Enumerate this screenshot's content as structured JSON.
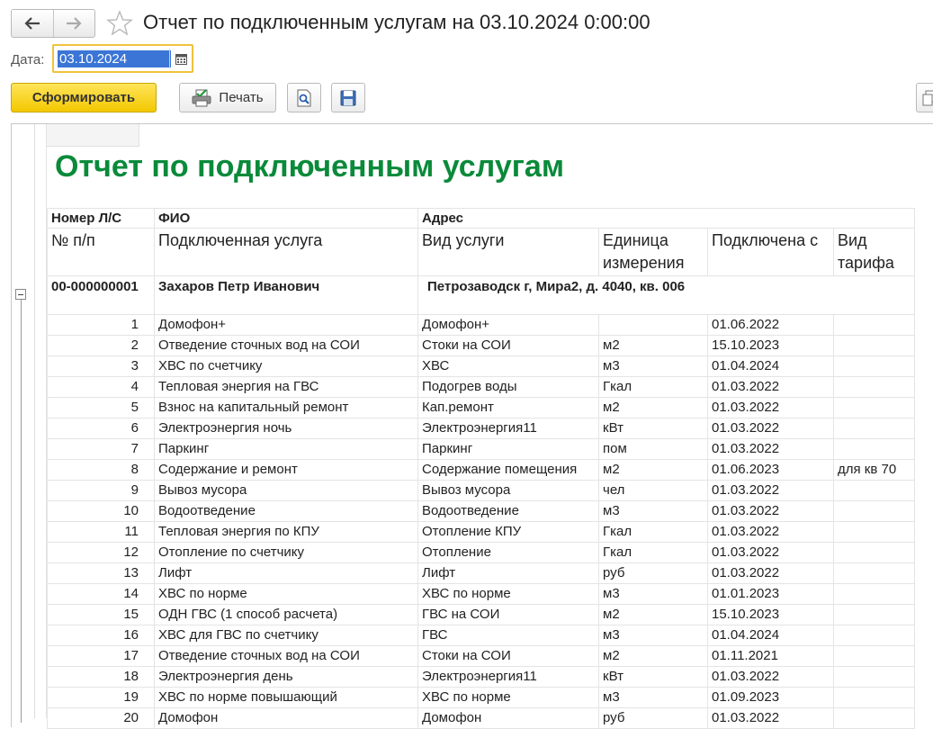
{
  "window": {
    "title": "Отчет по подключенным услугам на 03.10.2024 0:00:00"
  },
  "params": {
    "date_label": "Дата:",
    "date_value": "03.10.2024"
  },
  "toolbar": {
    "generate_label": "Сформировать",
    "print_label": "Печать"
  },
  "report": {
    "title": "Отчет по подключенным услугам",
    "header1": {
      "account": "Номер Л/С",
      "fio": "ФИО",
      "address": "Адрес"
    },
    "header2": {
      "num": "№ п/п",
      "service": "Подключенная услуга",
      "kind": "Вид услуги",
      "unit": "Единица измерения",
      "connected": "Подключена с",
      "tariff": "Вид тарифа"
    },
    "group": {
      "account": "00-000000001",
      "fio": "Захаров Петр Иванович",
      "address": "Петрозаводск г, Мира2, д. 4040, кв. 006"
    },
    "rows": [
      {
        "n": "1",
        "service": "Домофон+",
        "kind": "Домофон+",
        "unit": "",
        "date": "01.06.2022",
        "tariff": ""
      },
      {
        "n": "2",
        "service": "Отведение сточных вод на СОИ",
        "kind": "Стоки на СОИ",
        "unit": "м2",
        "date": "15.10.2023",
        "tariff": ""
      },
      {
        "n": "3",
        "service": "ХВС по счетчику",
        "kind": "ХВС",
        "unit": "м3",
        "date": "01.04.2024",
        "tariff": ""
      },
      {
        "n": "4",
        "service": "Тепловая энергия на ГВС",
        "kind": "Подогрев воды",
        "unit": "Гкал",
        "date": "01.03.2022",
        "tariff": ""
      },
      {
        "n": "5",
        "service": "Взнос на капитальный ремонт",
        "kind": "Кап.ремонт",
        "unit": "м2",
        "date": "01.03.2022",
        "tariff": ""
      },
      {
        "n": "6",
        "service": "Электроэнергия ночь",
        "kind": "Электроэнергия11",
        "unit": "кВт",
        "date": "01.03.2022",
        "tariff": ""
      },
      {
        "n": "7",
        "service": "Паркинг",
        "kind": "Паркинг",
        "unit": "пом",
        "date": "01.03.2022",
        "tariff": ""
      },
      {
        "n": "8",
        "service": "Содержание и ремонт",
        "kind": "Содержание помещения",
        "unit": "м2",
        "date": "01.06.2023",
        "tariff": "для кв 70"
      },
      {
        "n": "9",
        "service": "Вывоз мусора",
        "kind": "Вывоз мусора",
        "unit": "чел",
        "date": "01.03.2022",
        "tariff": ""
      },
      {
        "n": "10",
        "service": "Водоотведение",
        "kind": "Водоотведение",
        "unit": "м3",
        "date": "01.03.2022",
        "tariff": ""
      },
      {
        "n": "11",
        "service": "Тепловая энергия по КПУ",
        "kind": "Отопление КПУ",
        "unit": "Гкал",
        "date": "01.03.2022",
        "tariff": ""
      },
      {
        "n": "12",
        "service": "Отопление по счетчику",
        "kind": "Отопление",
        "unit": "Гкал",
        "date": "01.03.2022",
        "tariff": ""
      },
      {
        "n": "13",
        "service": "Лифт",
        "kind": "Лифт",
        "unit": "руб",
        "date": "01.03.2022",
        "tariff": ""
      },
      {
        "n": "14",
        "service": "ХВС по норме",
        "kind": "ХВС по норме",
        "unit": "м3",
        "date": "01.01.2023",
        "tariff": ""
      },
      {
        "n": "15",
        "service": "ОДН ГВС (1 способ расчета)",
        "kind": "ГВС на СОИ",
        "unit": "м2",
        "date": "15.10.2023",
        "tariff": ""
      },
      {
        "n": "16",
        "service": "ХВС для ГВС по счетчику",
        "kind": "ГВС",
        "unit": "м3",
        "date": "01.04.2024",
        "tariff": ""
      },
      {
        "n": "17",
        "service": "Отведение сточных вод на СОИ",
        "kind": "Стоки на СОИ",
        "unit": "м2",
        "date": "01.11.2021",
        "tariff": ""
      },
      {
        "n": "18",
        "service": "Электроэнергия день",
        "kind": "Электроэнергия11",
        "unit": "кВт",
        "date": "01.03.2022",
        "tariff": ""
      },
      {
        "n": "19",
        "service": "ХВС по норме повышающий",
        "kind": "ХВС по норме",
        "unit": "м3",
        "date": "01.09.2023",
        "tariff": ""
      },
      {
        "n": "20",
        "service": "Домофон",
        "kind": "Домофон",
        "unit": "руб",
        "date": "01.03.2022",
        "tariff": ""
      }
    ]
  },
  "icons": {
    "back": "arrow-left-icon",
    "forward": "arrow-right-icon",
    "favorite": "star-icon",
    "calendar": "calendar-icon",
    "print": "printer-icon",
    "preview": "preview-icon",
    "save": "save-icon",
    "collapse": "collapse-icon"
  },
  "colors": {
    "accent_yellow": "#f3c800",
    "report_title_green": "#0a8a3a",
    "date_selection": "#3b75d6",
    "field_focus": "#f0c23b"
  }
}
